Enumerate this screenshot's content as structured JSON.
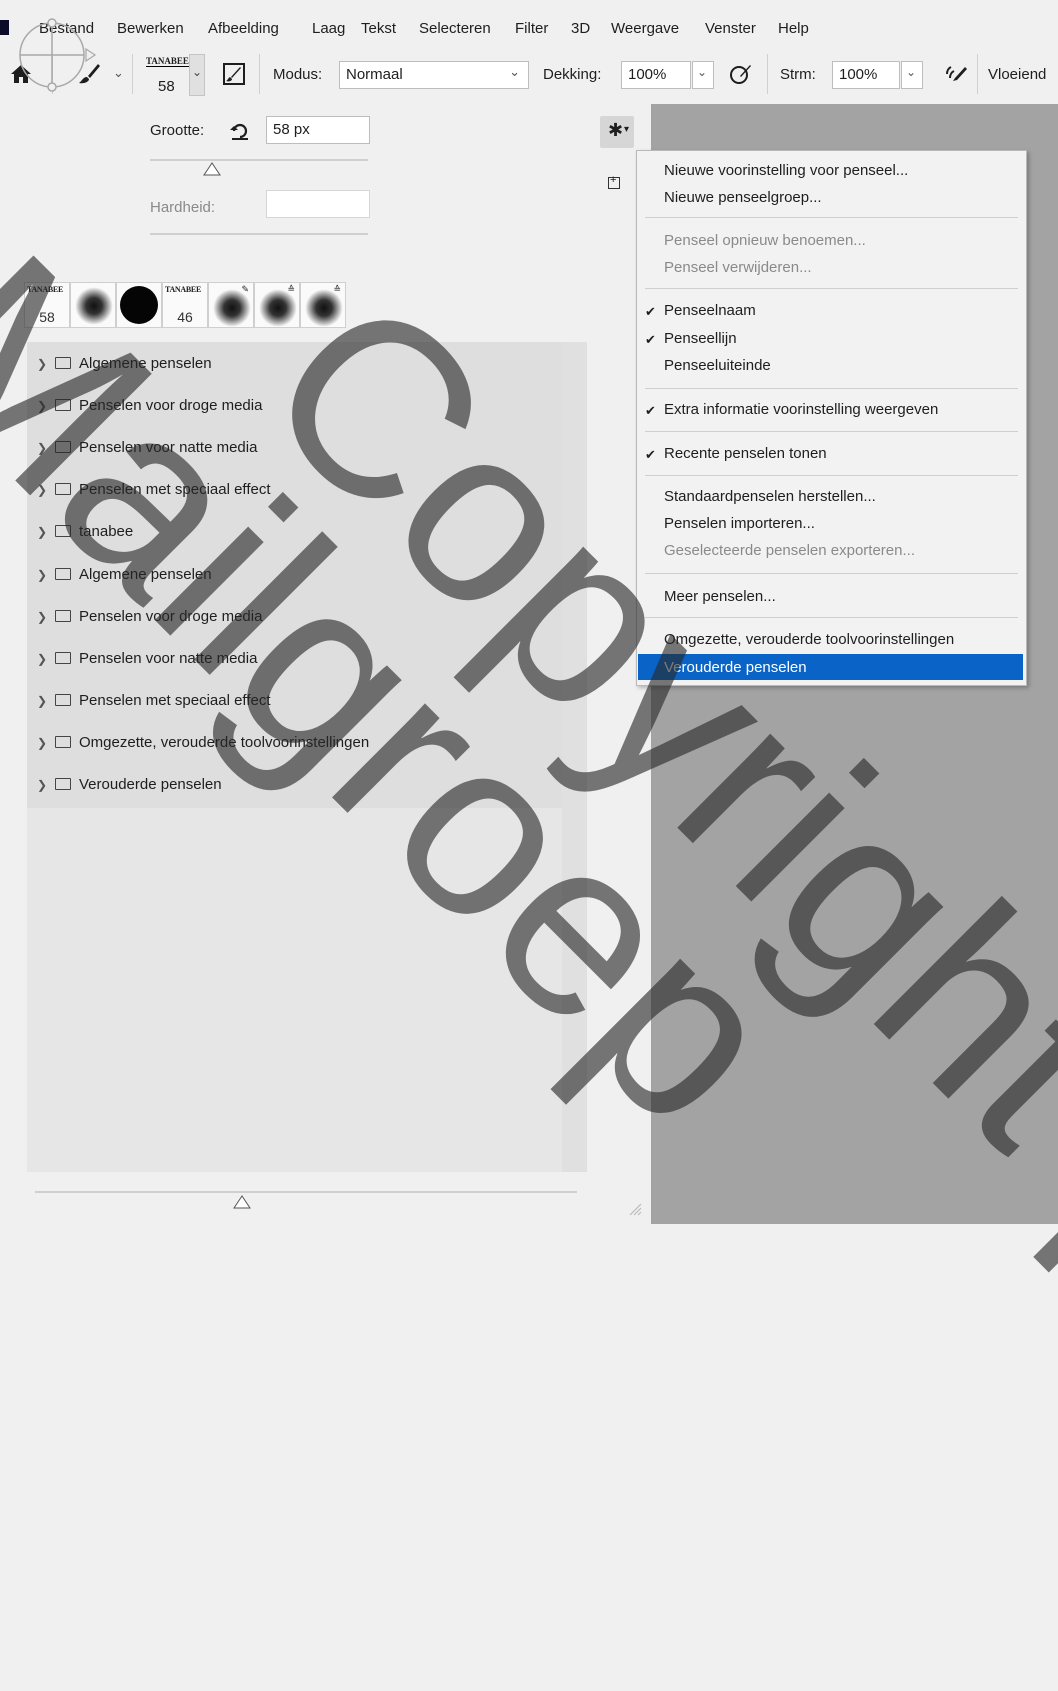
{
  "menubar": {
    "items": [
      "Bestand",
      "Bewerken",
      "Afbeelding",
      "Laag",
      "Tekst",
      "Selecteren",
      "Filter",
      "3D",
      "Weergave",
      "Venster",
      "Help"
    ]
  },
  "options_bar": {
    "home_icon": "home-icon",
    "brush_tool_icon": "brush-icon",
    "brush_preset_tag": "TANABEE",
    "brush_size": "58",
    "toggle_panel_icon": "brush-panel-icon",
    "mode_label": "Modus:",
    "mode_value": "Normaal",
    "opacity_label": "Dekking:",
    "opacity_value": "100%",
    "pressure_opacity_icon": "pressure-icon",
    "flow_label": "Strm:",
    "flow_value": "100%",
    "airbrush_icon": "airbrush-icon",
    "smoothing_label": "Vloeiend"
  },
  "brush_panel": {
    "size_label": "Grootte:",
    "size_value": "58 px",
    "hardness_label": "Hardheid:",
    "hardness_value": "",
    "reset_icon": "reset-icon",
    "gear_icon": "gear-icon",
    "new_group_icon": "plus-icon",
    "recent_presets": [
      {
        "tag": "TANABEE",
        "size": "58"
      },
      {
        "tag": "",
        "size": ""
      },
      {
        "tag": "",
        "size": ""
      },
      {
        "tag": "TANABEE",
        "size": "46"
      },
      {
        "tag": "",
        "size": ""
      },
      {
        "tag": "",
        "size": ""
      },
      {
        "tag": "",
        "size": ""
      }
    ],
    "groups": [
      "Algemene penselen",
      "Penselen voor droge media",
      "Penselen voor natte media",
      "Penselen met speciaal effect",
      "tanabee",
      "Algemene penselen",
      "Penselen voor droge media",
      "Penselen voor natte media",
      "Penselen met speciaal effect",
      "Omgezette, verouderde toolvoorinstellingen",
      "Verouderde penselen"
    ]
  },
  "flyout_menu": {
    "items": [
      {
        "label": "Nieuwe voorinstelling voor penseel...",
        "enabled": true,
        "checked": false
      },
      {
        "label": "Nieuwe penseelgroep...",
        "enabled": true,
        "checked": false
      },
      {
        "label": "Penseel opnieuw benoemen...",
        "enabled": false,
        "checked": false
      },
      {
        "label": "Penseel verwijderen...",
        "enabled": false,
        "checked": false
      },
      {
        "label": "Penseelnaam",
        "enabled": true,
        "checked": true
      },
      {
        "label": "Penseellijn",
        "enabled": true,
        "checked": true
      },
      {
        "label": "Penseeluiteinde",
        "enabled": true,
        "checked": false
      },
      {
        "label": "Extra informatie voorinstelling weergeven",
        "enabled": true,
        "checked": true
      },
      {
        "label": "Recente penselen tonen",
        "enabled": true,
        "checked": true
      },
      {
        "label": "Standaardpenselen herstellen...",
        "enabled": true,
        "checked": false
      },
      {
        "label": "Penselen importeren...",
        "enabled": true,
        "checked": false
      },
      {
        "label": "Geselecteerde penselen exporteren...",
        "enabled": false,
        "checked": false
      },
      {
        "label": "Meer penselen...",
        "enabled": true,
        "checked": false
      },
      {
        "label": "Omgezette, verouderde toolvoorinstellingen",
        "enabled": true,
        "checked": false
      },
      {
        "label": "Verouderde penselen",
        "enabled": true,
        "checked": false,
        "highlighted": true
      }
    ],
    "highlight_color": "#0a64c8"
  },
  "watermark": {
    "lines": [
      "Mailgroep",
      "Copyright photo"
    ]
  }
}
